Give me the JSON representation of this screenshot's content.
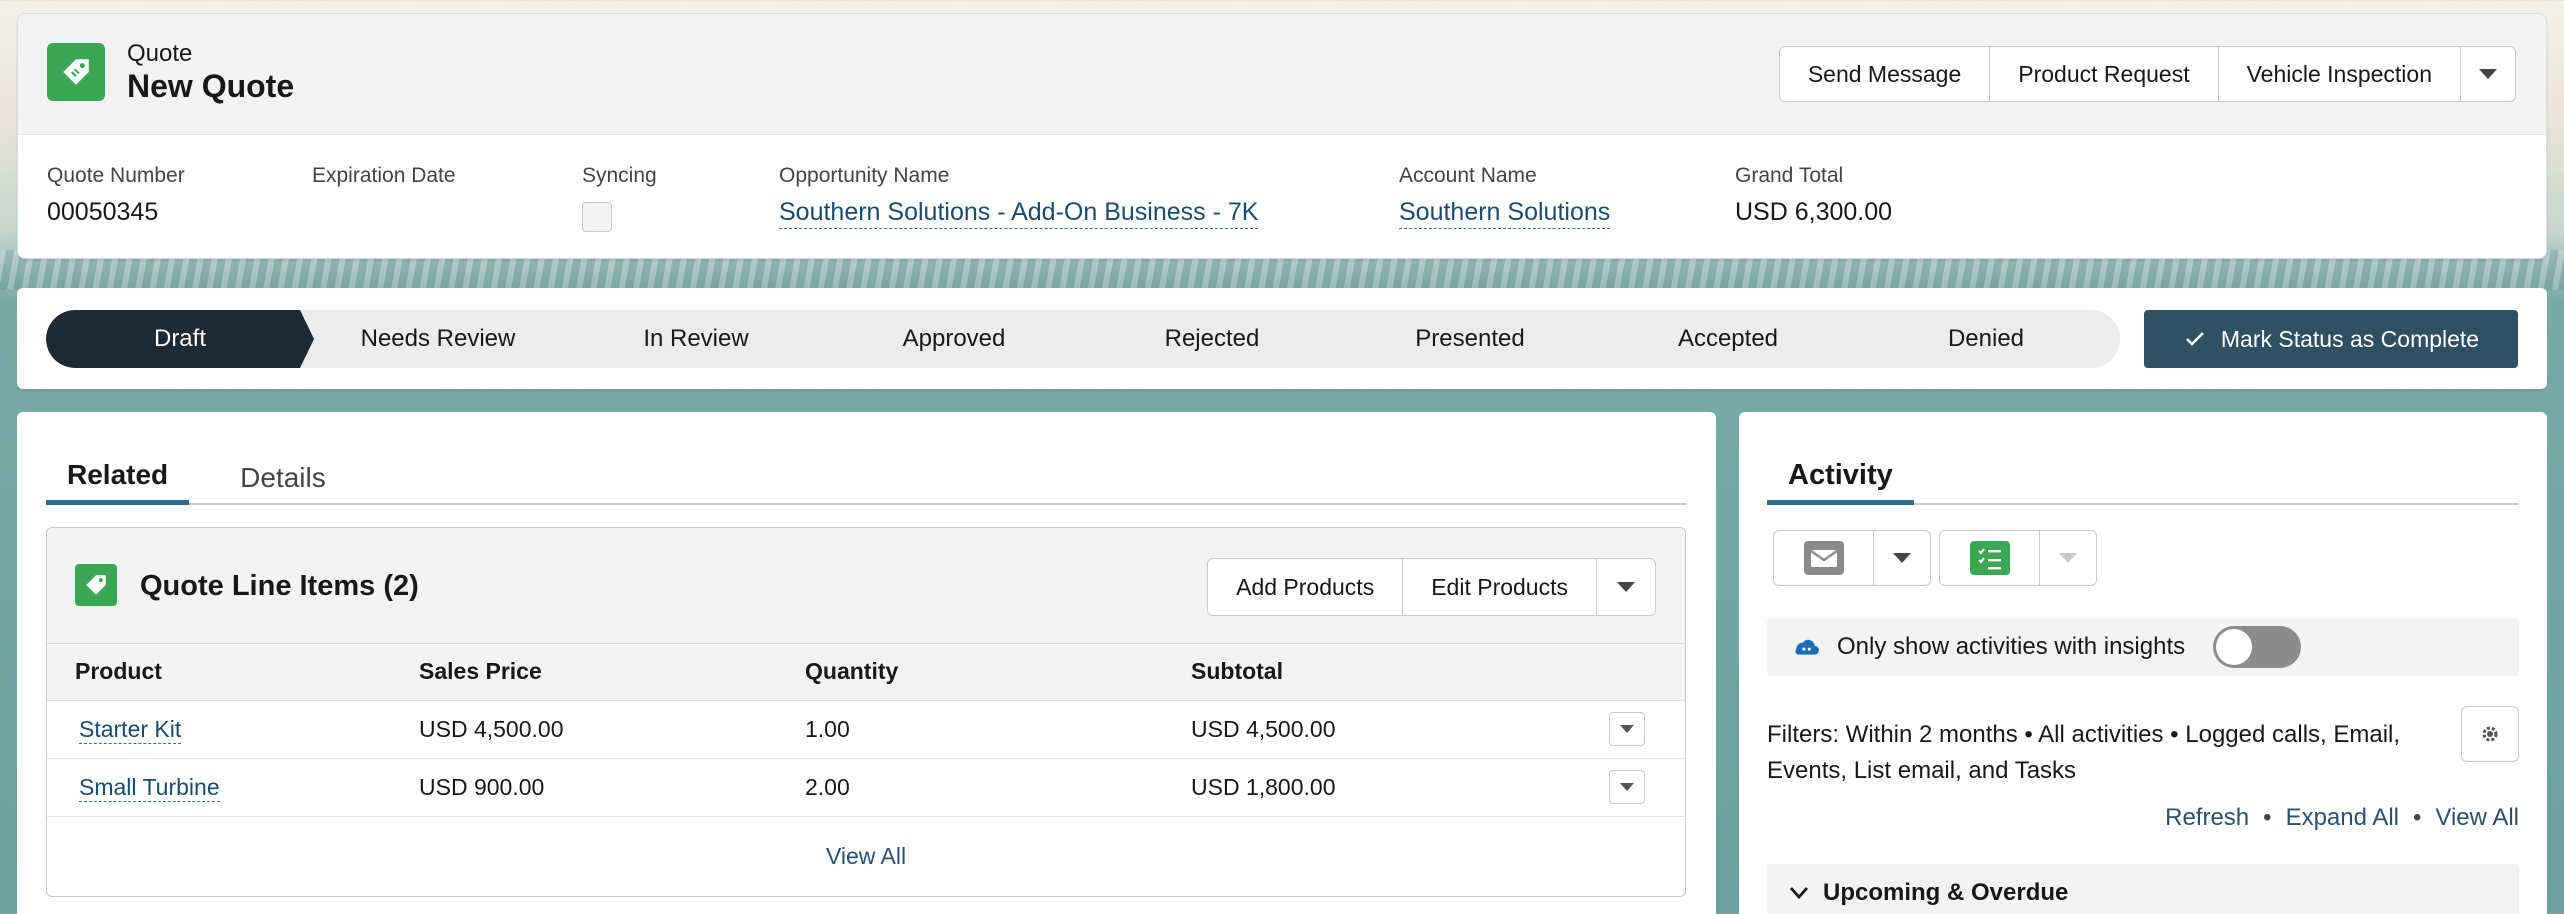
{
  "header": {
    "object_type": "Quote",
    "title": "New Quote",
    "actions": [
      "Send Message",
      "Product Request",
      "Vehicle Inspection"
    ],
    "fields": {
      "quote_number_label": "Quote Number",
      "quote_number": "00050345",
      "expiration_date_label": "Expiration Date",
      "expiration_date": "",
      "syncing_label": "Syncing",
      "syncing": false,
      "opportunity_label": "Opportunity Name",
      "opportunity": "Southern Solutions - Add-On Business - 7K",
      "account_label": "Account Name",
      "account": "Southern Solutions",
      "grand_total_label": "Grand Total",
      "grand_total": "USD 6,300.00"
    }
  },
  "path": {
    "stages": [
      "Draft",
      "Needs Review",
      "In Review",
      "Approved",
      "Rejected",
      "Presented",
      "Accepted",
      "Denied"
    ],
    "current": "Draft",
    "mark_complete_label": "Mark Status as Complete"
  },
  "related": {
    "tabs": [
      "Related",
      "Details"
    ],
    "active_tab": "Related",
    "list": {
      "title": "Quote Line Items (2)",
      "buttons": [
        "Add Products",
        "Edit Products"
      ],
      "columns": [
        "Product",
        "Sales Price",
        "Quantity",
        "Subtotal"
      ],
      "rows": [
        {
          "product": "Starter Kit",
          "sales_price": "USD 4,500.00",
          "quantity": "1.00",
          "subtotal": "USD 4,500.00"
        },
        {
          "product": "Small Turbine",
          "sales_price": "USD 900.00",
          "quantity": "2.00",
          "subtotal": "USD 1,800.00"
        }
      ],
      "view_all": "View All"
    }
  },
  "activity": {
    "tab": "Activity",
    "insights_label": "Only show activities with insights",
    "insights_enabled": false,
    "filters": "Filters: Within 2 months • All activities • Logged calls, Email, Events, List email, and Tasks",
    "links": [
      "Refresh",
      "Expand All",
      "View All"
    ],
    "section": "Upcoming & Overdue"
  },
  "colors": {
    "brand_green": "#3ba755",
    "path_current": "#1b2a35",
    "primary_button": "#2f4f63",
    "link": "#1a4c6e"
  }
}
